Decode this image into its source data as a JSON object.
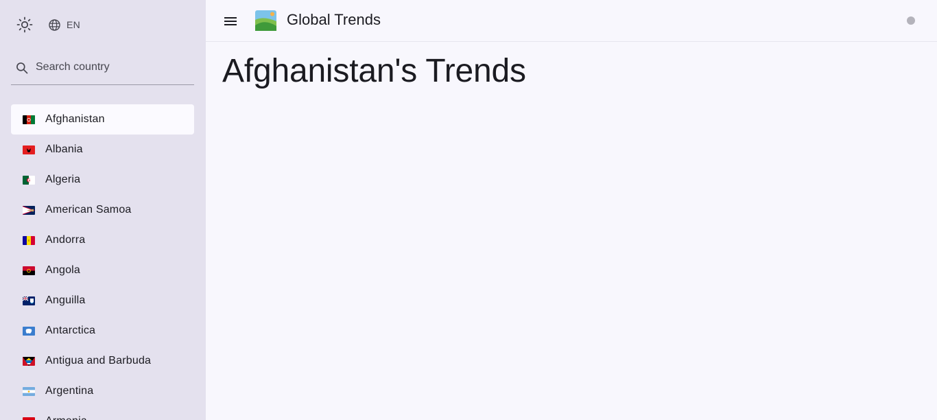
{
  "app": {
    "title": "Global Trends",
    "language": "EN"
  },
  "search": {
    "placeholder": "Search country"
  },
  "page": {
    "title": "Afghanistan's Trends"
  },
  "countries": [
    {
      "name": "Afghanistan",
      "flag": "flag-af",
      "active": true
    },
    {
      "name": "Albania",
      "flag": "flag-al"
    },
    {
      "name": "Algeria",
      "flag": "flag-dz"
    },
    {
      "name": "American Samoa",
      "flag": "flag-as"
    },
    {
      "name": "Andorra",
      "flag": "flag-ad"
    },
    {
      "name": "Angola",
      "flag": "flag-ao"
    },
    {
      "name": "Anguilla",
      "flag": "flag-ai"
    },
    {
      "name": "Antarctica",
      "flag": "flag-aq"
    },
    {
      "name": "Antigua and Barbuda",
      "flag": "flag-ag"
    },
    {
      "name": "Argentina",
      "flag": "flag-ar"
    },
    {
      "name": "Armenia",
      "flag": "flag-am"
    }
  ],
  "icons": {
    "theme": "sun-icon",
    "language": "globe-icon",
    "search": "search-icon",
    "menu": "menu-icon",
    "logo": "landscape-logo"
  },
  "colors": {
    "sidebar_bg": "#e4e1ee",
    "active_item_bg": "#fbfaff",
    "page_bg": "#f8f7fd",
    "status_dot": "#b4b3bb"
  }
}
